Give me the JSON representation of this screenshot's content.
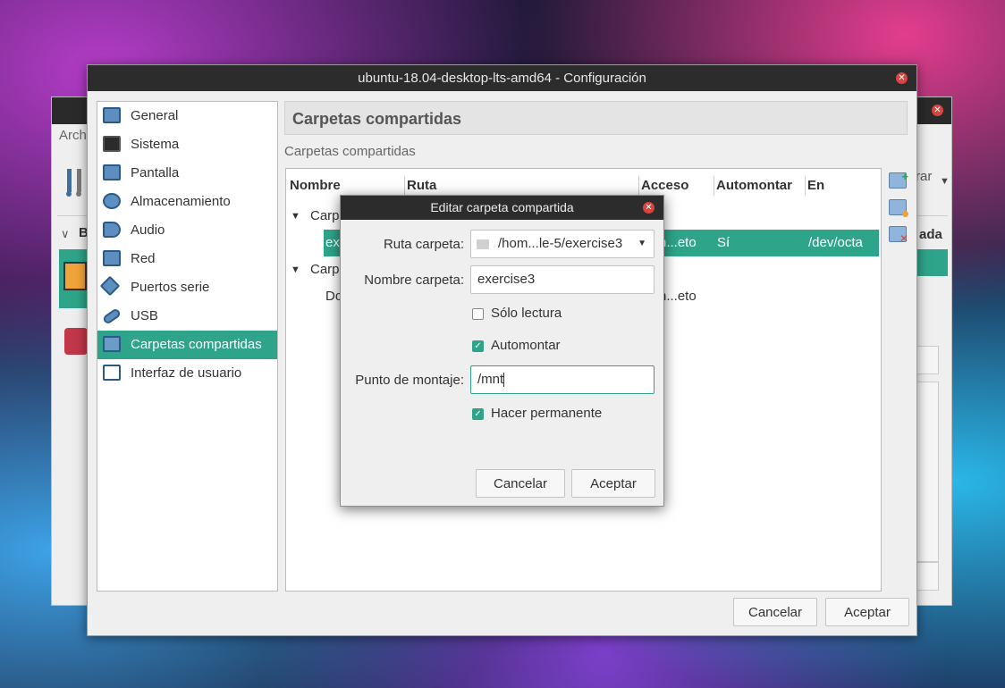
{
  "back_window": {
    "menu_fragment": "Arch",
    "toolbar_fragment": "rar",
    "section_fragment": "B",
    "column_fragment": "ada"
  },
  "main_window": {
    "title": "ubuntu-18.04-desktop-lts-amd64 - Configuración",
    "sidebar": {
      "items": [
        {
          "label": "General",
          "icon": "monitor-icon"
        },
        {
          "label": "Sistema",
          "icon": "chip-icon"
        },
        {
          "label": "Pantalla",
          "icon": "display-icon"
        },
        {
          "label": "Almacenamiento",
          "icon": "disk-icon"
        },
        {
          "label": "Audio",
          "icon": "speaker-icon"
        },
        {
          "label": "Red",
          "icon": "network-icon"
        },
        {
          "label": "Puertos serie",
          "icon": "serial-port-icon"
        },
        {
          "label": "USB",
          "icon": "usb-icon"
        },
        {
          "label": "Carpetas compartidas",
          "icon": "folder-icon"
        },
        {
          "label": "Interfaz de usuario",
          "icon": "window-icon"
        }
      ],
      "selected": "Carpetas compartidas"
    },
    "section_header": "Carpetas compartidas",
    "section_label": "Carpetas compartidas",
    "table": {
      "columns": [
        "Nombre",
        "Ruta",
        "Acceso",
        "Automontar",
        "En"
      ],
      "rows": [
        {
          "name": "Carp",
          "type": "group"
        },
        {
          "name": "ex",
          "access": "n...eto",
          "automount": "Sí",
          "at": "/dev/octa",
          "selected": true
        },
        {
          "name": "Carp",
          "type": "group"
        },
        {
          "name": "Do",
          "access": "n...eto"
        }
      ]
    },
    "buttons": {
      "cancel": "Cancelar",
      "accept": "Aceptar"
    }
  },
  "dialog": {
    "title": "Editar carpeta compartida",
    "ruta_label": "Ruta carpeta:",
    "ruta_value": "/hom...le-5/exercise3",
    "nombre_label": "Nombre carpeta:",
    "nombre_value": "exercise3",
    "solo_lectura_label": "Sólo lectura",
    "solo_lectura_checked": false,
    "automontar_label": "Automontar",
    "automontar_checked": true,
    "punto_label": "Punto de montaje:",
    "punto_value": "/mnt",
    "permanente_label": "Hacer permanente",
    "permanente_checked": true,
    "cancel": "Cancelar",
    "accept": "Aceptar"
  },
  "colors": {
    "accent": "#2ea58a",
    "titlebar": "#2c2c2c",
    "close": "#d9443e"
  }
}
